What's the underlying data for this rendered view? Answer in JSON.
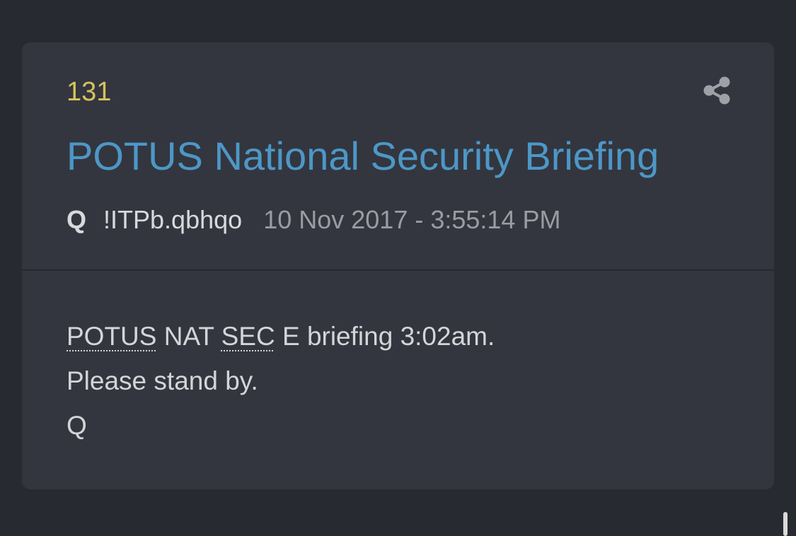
{
  "post": {
    "number": "131",
    "title": "POTUS National Security Briefing",
    "author": "Q",
    "tripcode": "!ITPb.qbhqo",
    "timestamp": "10 Nov 2017 - 3:55:14 PM",
    "share_icon": "share-icon",
    "body": {
      "line1": {
        "abbr1": "POTUS",
        "text1": " NAT ",
        "abbr2": "SEC",
        "text2": " E briefing 3:02am."
      },
      "line2": "Please stand by.",
      "line3": "Q"
    }
  },
  "colors": {
    "background": "#272a31",
    "card": "#33363f",
    "number": "#d6c35b",
    "title": "#4d97c6",
    "text": "#d4d5d8",
    "timestamp": "#9a9ca3"
  }
}
